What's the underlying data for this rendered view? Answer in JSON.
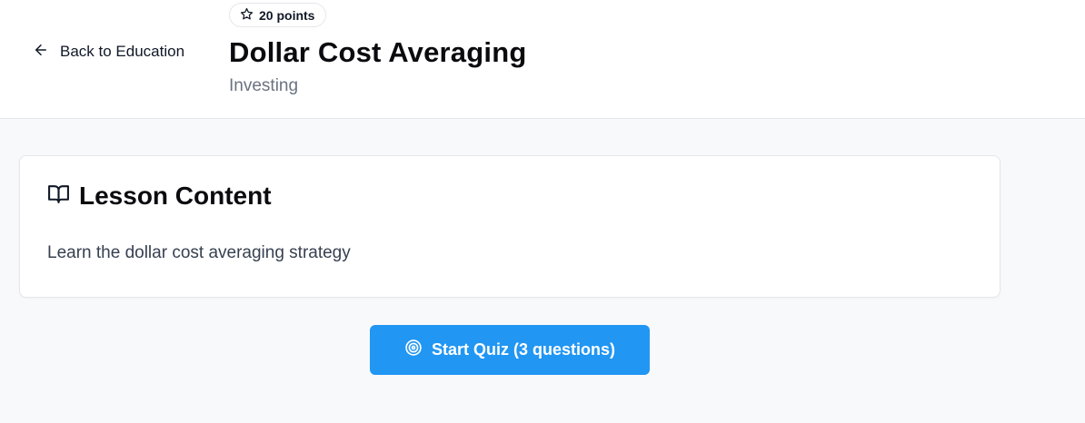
{
  "header": {
    "back_label": "Back to Education",
    "points": "20 points",
    "title": "Dollar Cost Averaging",
    "category": "Investing"
  },
  "lesson": {
    "heading": "Lesson Content",
    "body": "Learn the dollar cost averaging strategy"
  },
  "quiz": {
    "button_label": "Start Quiz (3 questions)"
  },
  "colors": {
    "accent": "#2196f3",
    "background": "#f8f9fb",
    "card": "#ffffff",
    "muted_text": "#6b7280"
  },
  "icons": {
    "back": "arrow-left-icon",
    "points": "star-icon",
    "lesson": "book-open-icon",
    "quiz": "target-icon"
  }
}
